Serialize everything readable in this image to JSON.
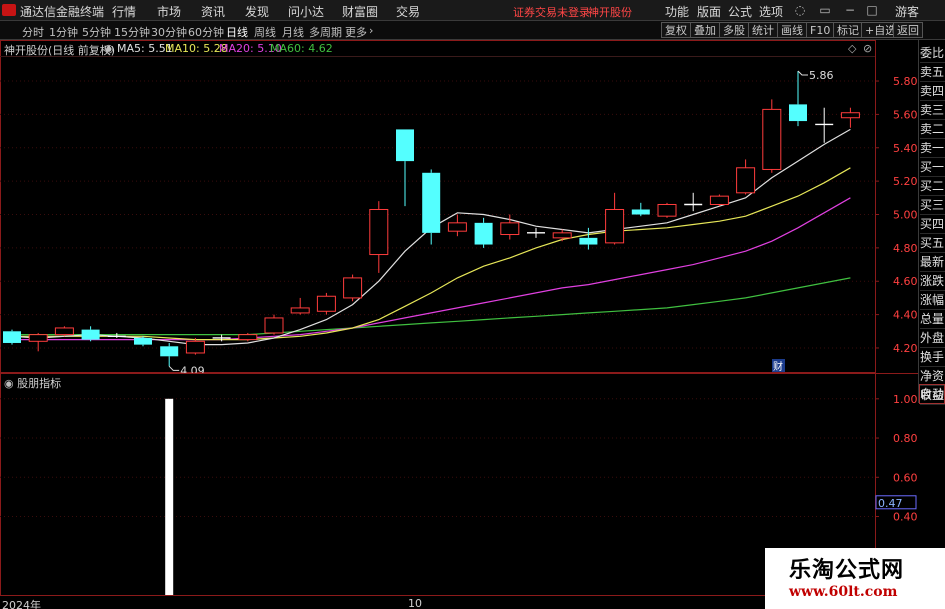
{
  "app": {
    "title": "通达信金融终端",
    "menu": [
      "行情",
      "市场",
      "资讯",
      "发现",
      "问小达",
      "财富圈",
      "交易"
    ],
    "warning": "证券交易未登录",
    "stock_top": "神开股份",
    "right_menu": [
      "功能",
      "版面",
      "公式",
      "选项"
    ],
    "guest": "游客"
  },
  "toolbar": {
    "periods": [
      "分时",
      "1分钟",
      "5分钟",
      "15分钟",
      "30分钟",
      "60分钟",
      "日线",
      "周线",
      "月线",
      "多周期",
      "更多"
    ],
    "active_period": "日线",
    "more_arrow": "›",
    "right_buttons": [
      "复权",
      "叠加",
      "多股",
      "统计",
      "画线",
      "F10",
      "标记",
      "+自选",
      "返回"
    ]
  },
  "chart": {
    "stock_label": "神开股份(日线 前复权)",
    "ma": [
      {
        "label": "MA5: 5.51",
        "color": "#e0e0e0"
      },
      {
        "label": "MA10: 5.28",
        "color": "#e6e658"
      },
      {
        "label": "MA20: 5.10",
        "color": "#e040e0"
      },
      {
        "label": "MA60: 4.62",
        "color": "#40c040"
      }
    ],
    "high_label": "5.86",
    "low_label": "4.09",
    "cai_label": "财",
    "price_axis": [
      "5.80",
      "5.60",
      "5.40",
      "5.20",
      "5.00",
      "4.80",
      "4.60",
      "4.40",
      "4.20"
    ]
  },
  "indicator": {
    "title": "股朋指标",
    "axis": [
      "1.00",
      "0.80",
      "0.60",
      "0.40"
    ],
    "current": "0.47"
  },
  "side_panel": [
    "委比",
    "卖五",
    "卖四",
    "卖三",
    "卖二",
    "卖一",
    "买一",
    "买二",
    "买三",
    "买四",
    "买五",
    "最新",
    "涨跌",
    "涨幅",
    "总量",
    "外盘",
    "换手",
    "净资",
    "收益",
    "自动"
  ],
  "time_axis": [
    "2024年",
    "10"
  ],
  "watermark": {
    "line1": "乐淘公式网",
    "line2": "www.60lt.com"
  },
  "colors": {
    "up": "#ff3c3c",
    "down": "#54ffff",
    "ma5": "#e0e0e0",
    "ma10": "#e6e658",
    "ma20": "#e040e0",
    "ma60": "#40c040",
    "grid": "#8b1a1a"
  },
  "chart_data": {
    "type": "candlestick",
    "price_range": [
      4.05,
      5.95
    ],
    "candles": [
      {
        "o": 4.3,
        "c": 4.23,
        "h": 4.31,
        "l": 4.22
      },
      {
        "o": 4.24,
        "c": 4.28,
        "h": 4.29,
        "l": 4.18
      },
      {
        "o": 4.28,
        "c": 4.32,
        "h": 4.33,
        "l": 4.27
      },
      {
        "o": 4.31,
        "c": 4.25,
        "h": 4.33,
        "l": 4.24
      },
      {
        "o": 4.27,
        "c": 4.27,
        "h": 4.29,
        "l": 4.26
      },
      {
        "o": 4.26,
        "c": 4.22,
        "h": 4.27,
        "l": 4.21
      },
      {
        "o": 4.21,
        "c": 4.15,
        "h": 4.23,
        "l": 4.09
      },
      {
        "o": 4.17,
        "c": 4.24,
        "h": 4.26,
        "l": 4.16
      },
      {
        "o": 4.26,
        "c": 4.26,
        "h": 4.28,
        "l": 4.24
      },
      {
        "o": 4.25,
        "c": 4.28,
        "h": 4.29,
        "l": 4.24
      },
      {
        "o": 4.29,
        "c": 4.38,
        "h": 4.4,
        "l": 4.28
      },
      {
        "o": 4.41,
        "c": 4.44,
        "h": 4.5,
        "l": 4.4
      },
      {
        "o": 4.42,
        "c": 4.51,
        "h": 4.53,
        "l": 4.4
      },
      {
        "o": 4.5,
        "c": 4.62,
        "h": 4.64,
        "l": 4.48
      },
      {
        "o": 4.76,
        "c": 5.03,
        "h": 5.08,
        "l": 4.65
      },
      {
        "o": 5.51,
        "c": 5.32,
        "h": 5.51,
        "l": 5.05
      },
      {
        "o": 5.25,
        "c": 4.89,
        "h": 5.27,
        "l": 4.82
      },
      {
        "o": 4.9,
        "c": 4.95,
        "h": 5.0,
        "l": 4.87
      },
      {
        "o": 4.95,
        "c": 4.82,
        "h": 4.98,
        "l": 4.8
      },
      {
        "o": 4.88,
        "c": 4.95,
        "h": 5.0,
        "l": 4.85
      },
      {
        "o": 4.89,
        "c": 4.89,
        "h": 4.92,
        "l": 4.86
      },
      {
        "o": 4.86,
        "c": 4.89,
        "h": 4.91,
        "l": 4.84
      },
      {
        "o": 4.86,
        "c": 4.82,
        "h": 4.92,
        "l": 4.79
      },
      {
        "o": 4.83,
        "c": 5.03,
        "h": 5.13,
        "l": 4.82
      },
      {
        "o": 5.03,
        "c": 5.0,
        "h": 5.07,
        "l": 4.99
      },
      {
        "o": 4.99,
        "c": 5.06,
        "h": 5.07,
        "l": 4.98
      },
      {
        "o": 5.06,
        "c": 5.06,
        "h": 5.13,
        "l": 5.02
      },
      {
        "o": 5.06,
        "c": 5.11,
        "h": 5.12,
        "l": 5.05
      },
      {
        "o": 5.13,
        "c": 5.28,
        "h": 5.33,
        "l": 5.12
      },
      {
        "o": 5.27,
        "c": 5.63,
        "h": 5.69,
        "l": 5.25
      },
      {
        "o": 5.66,
        "c": 5.56,
        "h": 5.86,
        "l": 5.53
      },
      {
        "o": 5.54,
        "c": 5.54,
        "h": 5.64,
        "l": 5.43
      },
      {
        "o": 5.58,
        "c": 5.61,
        "h": 5.64,
        "l": 5.52
      }
    ],
    "ma5": [
      4.27,
      4.26,
      4.27,
      4.28,
      4.27,
      4.26,
      4.24,
      4.22,
      4.22,
      4.23,
      4.26,
      4.31,
      4.37,
      4.46,
      4.6,
      4.78,
      4.92,
      5.01,
      5.0,
      4.97,
      4.93,
      4.91,
      4.89,
      4.91,
      4.93,
      4.95,
      5.0,
      5.05,
      5.1,
      5.22,
      5.32,
      5.42,
      5.51
    ],
    "ma10": [
      4.27,
      4.27,
      4.27,
      4.27,
      4.27,
      4.27,
      4.26,
      4.25,
      4.25,
      4.25,
      4.26,
      4.27,
      4.29,
      4.32,
      4.37,
      4.45,
      4.53,
      4.62,
      4.69,
      4.74,
      4.8,
      4.85,
      4.88,
      4.9,
      4.91,
      4.92,
      4.94,
      4.96,
      4.99,
      5.05,
      5.11,
      5.19,
      5.28
    ],
    "ma20": [
      4.25,
      4.25,
      4.25,
      4.25,
      4.25,
      4.25,
      4.25,
      4.25,
      4.25,
      4.26,
      4.27,
      4.28,
      4.3,
      4.32,
      4.35,
      4.38,
      4.41,
      4.44,
      4.47,
      4.5,
      4.53,
      4.56,
      4.58,
      4.61,
      4.64,
      4.67,
      4.7,
      4.74,
      4.78,
      4.84,
      4.92,
      5.01,
      5.1
    ],
    "ma60": [
      4.28,
      4.28,
      4.28,
      4.28,
      4.28,
      4.28,
      4.28,
      4.28,
      4.28,
      4.28,
      4.29,
      4.3,
      4.31,
      4.32,
      4.33,
      4.34,
      4.35,
      4.36,
      4.37,
      4.38,
      4.39,
      4.4,
      4.41,
      4.42,
      4.43,
      4.44,
      4.46,
      4.48,
      4.5,
      4.53,
      4.56,
      4.59,
      4.62
    ],
    "indicator_bars": [
      {
        "index": 6,
        "value": 1.0
      }
    ],
    "indicator_range": [
      0.0,
      1.05
    ]
  }
}
